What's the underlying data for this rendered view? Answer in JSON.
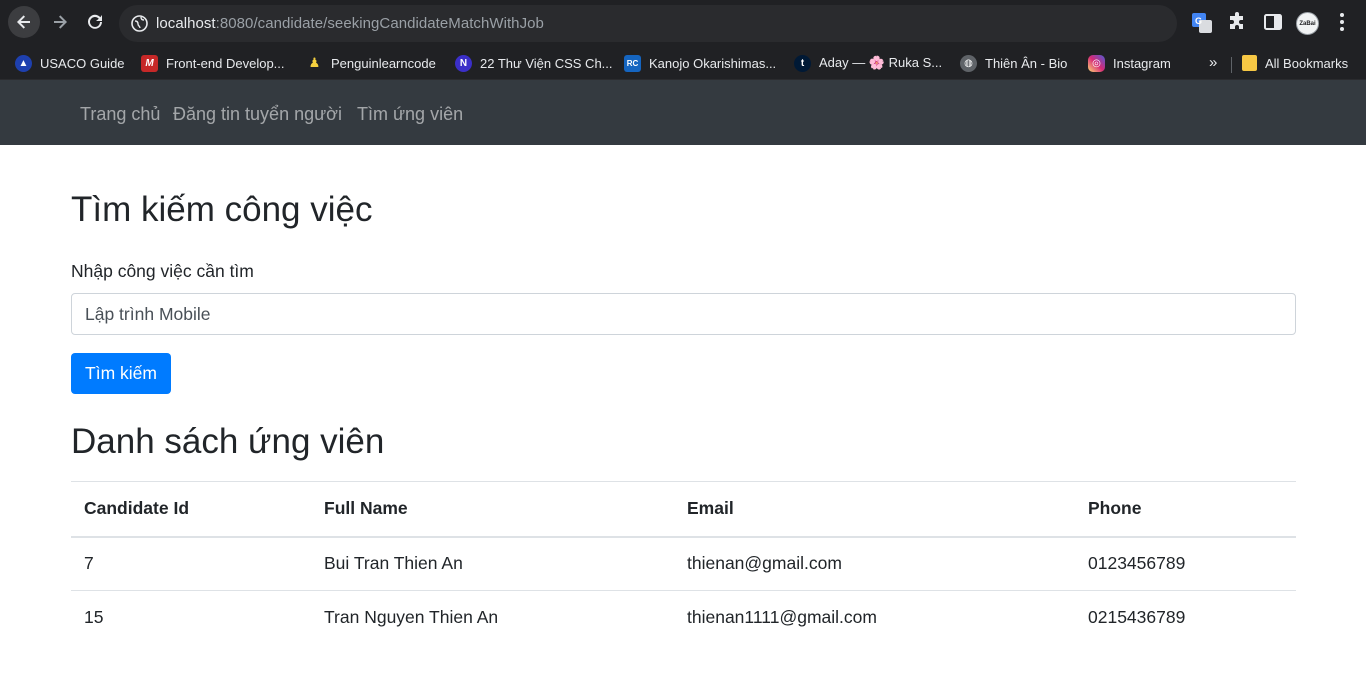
{
  "browser": {
    "url_host": "localhost",
    "url_rest": ":8080/candidate/seekingCandidateMatchWithJob",
    "profile_label": "ZaBai",
    "bookmarks": [
      {
        "label": "USACO Guide",
        "icon": "usaco-icon",
        "color": "#1e40af"
      },
      {
        "label": "Front-end Develop...",
        "icon": "fem-icon",
        "color": "#c62828"
      },
      {
        "label": "Penguinlearncode",
        "icon": "penguin-icon",
        "color": "#202124"
      },
      {
        "label": "22 Thư Viện CSS Ch...",
        "icon": "n-icon",
        "color": "#3b2fc9"
      },
      {
        "label": "Kanojo Okarishimas...",
        "icon": "rc-icon",
        "color": "#1565c0"
      },
      {
        "label": "Aday — 🌸 Ruka S...",
        "icon": "tumblr-icon",
        "color": "#001935"
      },
      {
        "label": "Thiên Ân - Bio",
        "icon": "globe-icon",
        "color": "#5f6368"
      },
      {
        "label": "Instagram",
        "icon": "instagram-icon",
        "color": "#d62976"
      }
    ],
    "more_label": "»",
    "all_bookmarks": "All Bookmarks"
  },
  "navbar": {
    "links": [
      "Trang chủ",
      "Đăng tin tuyển người",
      "Tìm ứng viên"
    ]
  },
  "search": {
    "heading": "Tìm kiếm công việc",
    "label": "Nhập công việc cần tìm",
    "value": "Lập trình Mobile",
    "button": "Tìm kiếm"
  },
  "candidates": {
    "heading": "Danh sách ứng viên",
    "columns": [
      "Candidate Id",
      "Full Name",
      "Email",
      "Phone"
    ],
    "rows": [
      [
        "7",
        "Bui Tran Thien An",
        "thienan@gmail.com",
        "0123456789"
      ],
      [
        "15",
        "Tran Nguyen Thien An",
        "thienan1111@gmail.com",
        "0215436789"
      ]
    ]
  },
  "colors": {
    "navbar": "#343a40",
    "primary": "#007bff",
    "browser_bg": "#202124"
  }
}
